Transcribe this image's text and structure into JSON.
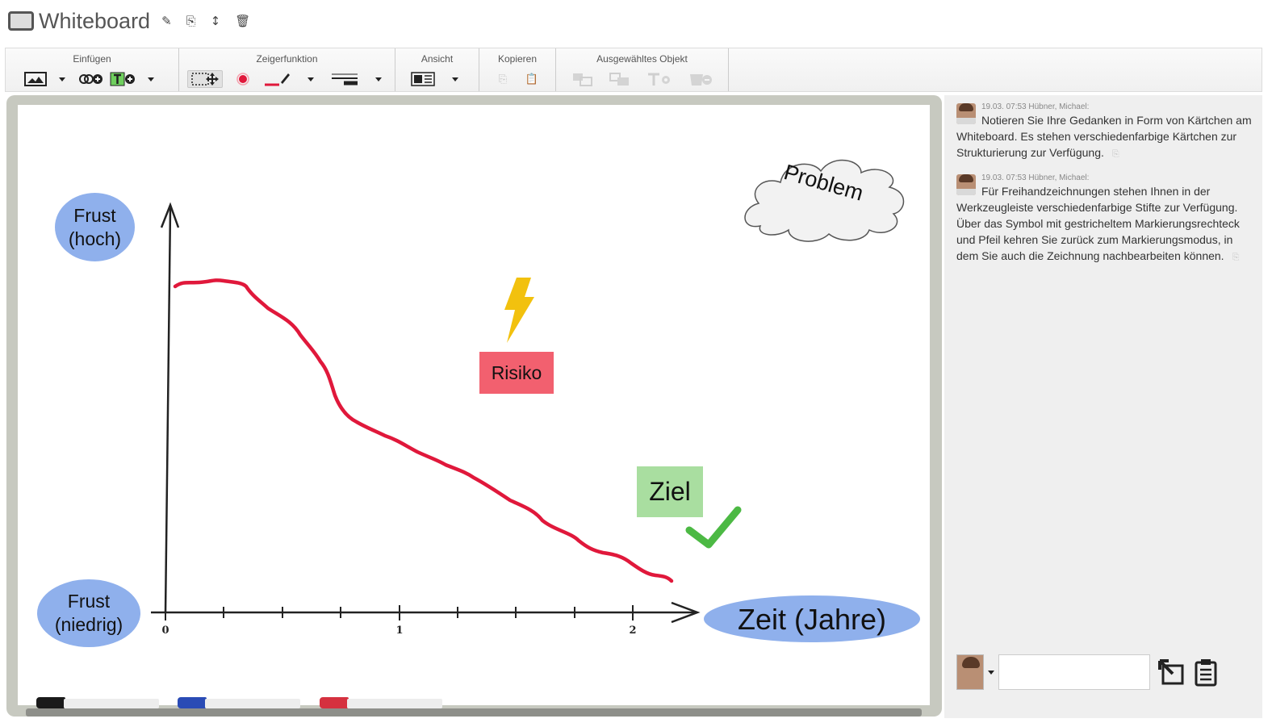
{
  "window": {
    "title": "Whiteboard",
    "title_icons": [
      "rename-icon",
      "copy-icon",
      "resize-vertical-icon",
      "trash-icon"
    ]
  },
  "toolbar": {
    "groups": [
      {
        "label": "Einfügen"
      },
      {
        "label": "Zeigerfunktion"
      },
      {
        "label": "Ansicht"
      },
      {
        "label": "Kopieren"
      },
      {
        "label": "Ausgewähltes Objekt"
      }
    ]
  },
  "board": {
    "labels": {
      "frust_high_line1": "Frust",
      "frust_high_line2": "(hoch)",
      "frust_low_line1": "Frust",
      "frust_low_line2": "(niedrig)",
      "time_axis": "Zeit (Jahre)",
      "problem": "Problem",
      "risk": "Risiko",
      "goal": "Ziel"
    },
    "axis_ticks": [
      "0",
      "1",
      "2"
    ],
    "colors": {
      "ellipse": "#8fb0ec",
      "risk_card": "#f2606f",
      "goal_card": "#a9dea0",
      "curve": "#e0183b",
      "checkmark": "#4cb944",
      "lightning": "#f2c10e"
    },
    "markers": [
      "black",
      "blue",
      "red"
    ]
  },
  "chat": {
    "messages": [
      {
        "meta": "19.03. 07:53 Hübner, Michael:",
        "text": "Notieren Sie Ihre Gedanken in Form von Kärtchen am Whiteboard. Es stehen verschiedenfarbige Kärtchen zur Strukturierung zur Verfügung."
      },
      {
        "meta": "19.03. 07:53 Hübner, Michael:",
        "text": "Für Freihandzeichnungen stehen Ihnen in der Werkzeugleiste verschiedenfarbige Stifte zur Verfügung. Über das Symbol mit gestricheltem Markierungsrechteck und Pfeil kehren Sie zurück zum Markierungsmodus, in dem Sie auch die Zeichnung nachbearbeiten können."
      }
    ],
    "input": {
      "value": "",
      "placeholder": ""
    }
  }
}
